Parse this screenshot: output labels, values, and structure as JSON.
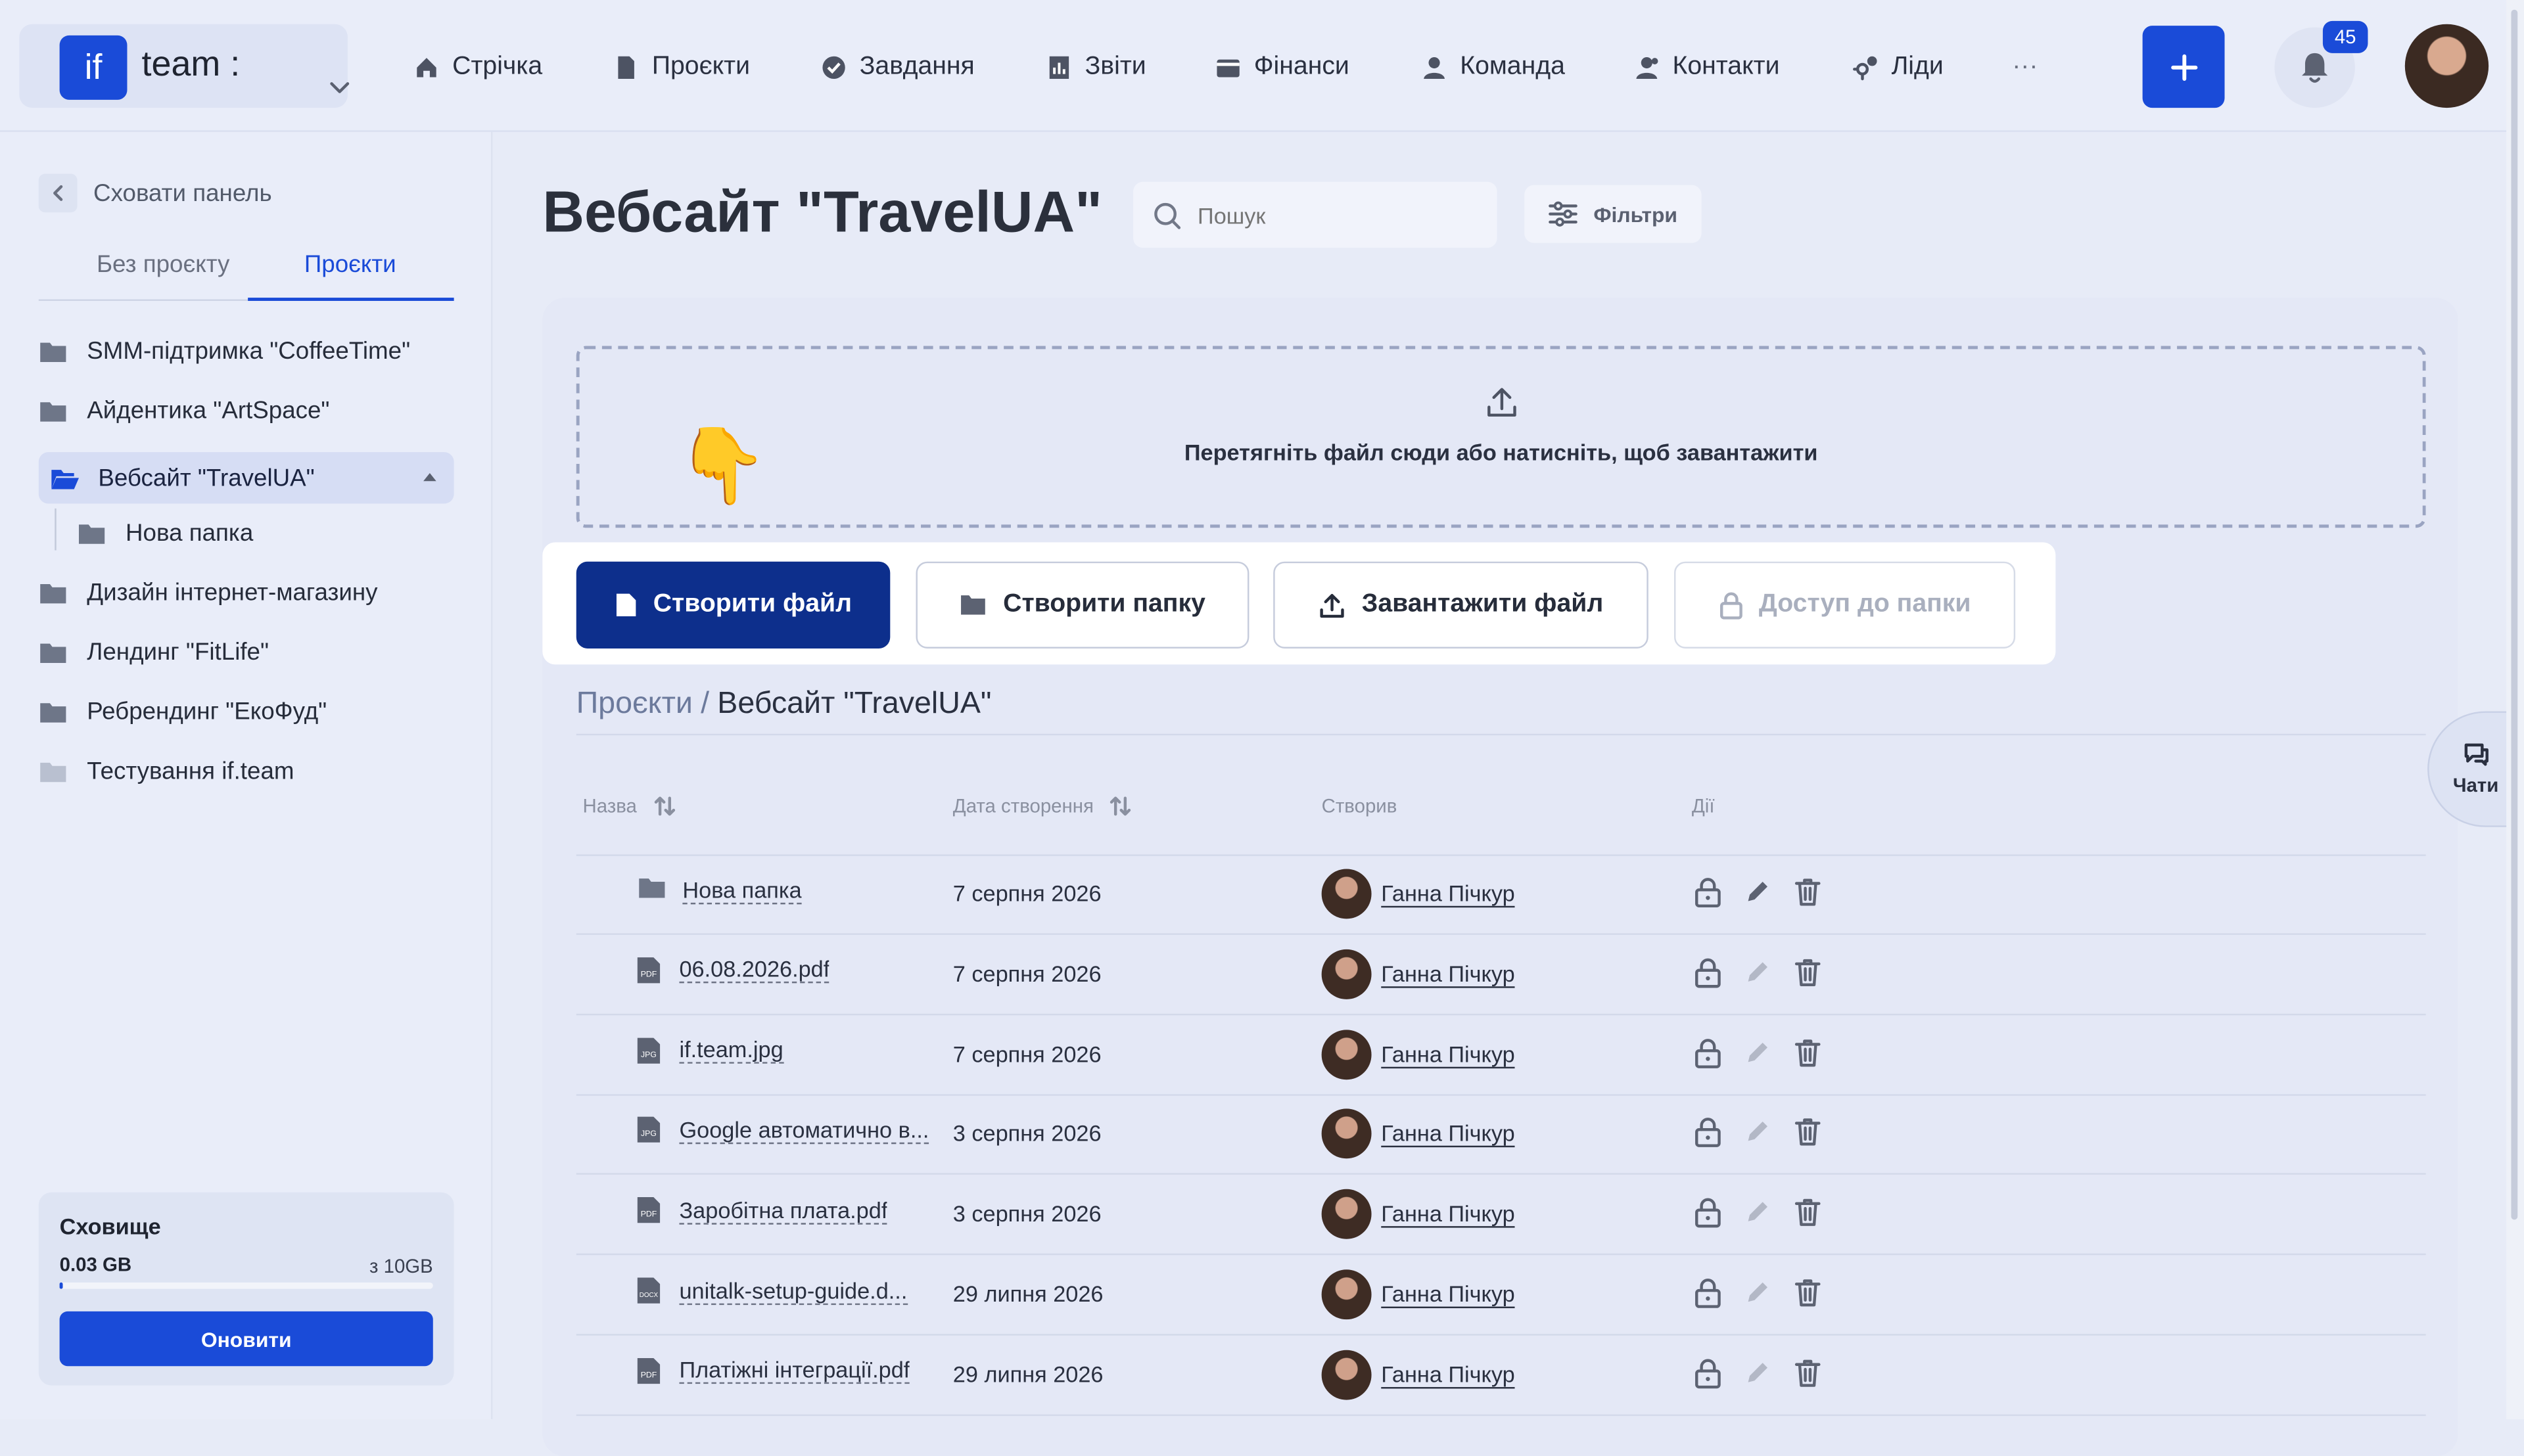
{
  "brand": {
    "logo_text": "if",
    "name": "team :"
  },
  "nav": [
    {
      "label": "Стрічка",
      "icon": "home-icon"
    },
    {
      "label": "Проєкти",
      "icon": "document-icon"
    },
    {
      "label": "Завдання",
      "icon": "check-circle-icon"
    },
    {
      "label": "Звіти",
      "icon": "chart-icon"
    },
    {
      "label": "Фінанси",
      "icon": "wallet-icon"
    },
    {
      "label": "Команда",
      "icon": "user-icon"
    },
    {
      "label": "Контакти",
      "icon": "contacts-icon"
    },
    {
      "label": "Ліди",
      "icon": "leads-icon"
    },
    {
      "label": "···",
      "icon": "more-icon"
    }
  ],
  "header": {
    "notifications_count": "45",
    "plus_label": "+"
  },
  "sidebar": {
    "hide_label": "Сховати панель",
    "tabs": [
      {
        "label": "Без проєкту"
      },
      {
        "label": "Проєкти"
      }
    ],
    "active_tab": 1,
    "items": [
      {
        "label": "SMM-підтримка \"CoffeeTime\""
      },
      {
        "label": "Айдентика \"ArtSpace\""
      },
      {
        "label": "Вебсайт \"TravelUA\""
      },
      {
        "label": "Нова папка"
      },
      {
        "label": "Дизайн інтернет-магазину"
      },
      {
        "label": "Лендинг \"FitLife\""
      },
      {
        "label": "Ребрендинг \"ЕкоФуд\""
      },
      {
        "label": "Тестування if.team"
      }
    ],
    "storage": {
      "title": "Сховище",
      "used": "0.03 GB",
      "max": "з 10GB",
      "used_fraction": 0.003,
      "button": "Оновити"
    }
  },
  "main": {
    "title": "Вебсайт \"TravelUA\"",
    "search_placeholder": "Пошук",
    "filters_label": "Фільтри",
    "dropzone_text": "Перетягніть файл сюди або натисніть, щоб завантажити",
    "hand_glyph": "👇",
    "buttons": {
      "create_file": "Створити файл",
      "create_folder": "Створити папку",
      "upload_file": "Завантажити файл",
      "folder_access": "Доступ до папки"
    },
    "breadcrumb": {
      "root": "Проєкти",
      "sep": "/",
      "current": "Вебсайт \"TravelUA\""
    },
    "table": {
      "headers": {
        "name": "Назва",
        "date": "Дата створення",
        "creator": "Створив",
        "actions": "Дії"
      },
      "rows": [
        {
          "name": "Нова папка",
          "type": "folder",
          "date": "7 серпня 2026",
          "creator": "Ганна Пічкур",
          "editable": true
        },
        {
          "name": "06.08.2026.pdf",
          "type": "pdf",
          "date": "7 серпня 2026",
          "creator": "Ганна Пічкур",
          "editable": false
        },
        {
          "name": "if.team.jpg",
          "type": "jpg",
          "date": "7 серпня 2026",
          "creator": "Ганна Пічкур",
          "editable": false
        },
        {
          "name": "Google автоматично в...",
          "type": "jpg",
          "date": "3 серпня 2026",
          "creator": "Ганна Пічкур",
          "editable": false
        },
        {
          "name": "Заробітна плата.pdf",
          "type": "pdf",
          "date": "3 серпня 2026",
          "creator": "Ганна Пічкур",
          "editable": false
        },
        {
          "name": "unitalk-setup-guide.d...",
          "type": "docx",
          "date": "29 липня 2026",
          "creator": "Ганна Пічкур",
          "editable": false
        },
        {
          "name": "Платіжні інтеграції.pdf",
          "type": "pdf",
          "date": "29 липня 2026",
          "creator": "Ганна Пічкур",
          "editable": false
        }
      ]
    }
  },
  "chat": {
    "label": "Чати"
  },
  "colors": {
    "accent": "#1a4bd8",
    "primary_dark": "#0d2f8c",
    "background": "#e7ebf7"
  }
}
